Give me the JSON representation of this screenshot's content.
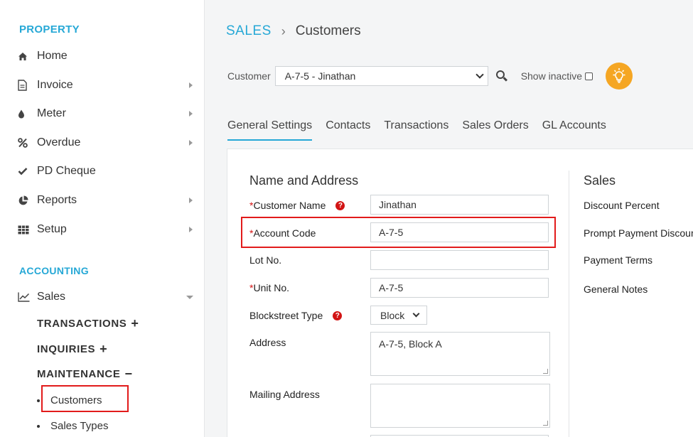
{
  "sidebar": {
    "property_heading": "PROPERTY",
    "property_items": [
      {
        "label": "Home",
        "icon": "home-icon"
      },
      {
        "label": "Invoice",
        "icon": "document-icon"
      },
      {
        "label": "Meter",
        "icon": "drop-icon"
      },
      {
        "label": "Overdue",
        "icon": "percent-icon"
      },
      {
        "label": "PD Cheque",
        "icon": "check-icon"
      },
      {
        "label": "Reports",
        "icon": "pie-chart-icon"
      },
      {
        "label": "Setup",
        "icon": "grid-icon"
      }
    ],
    "accounting_heading": "ACCOUNTING",
    "sales_label": "Sales",
    "sub_headings": {
      "transactions": "TRANSACTIONS",
      "inquiries": "INQUIRIES",
      "maintenance": "MAINTENANCE"
    },
    "plus_symbol": "+",
    "minus_symbol": "−",
    "maintenance_links": [
      "Customers",
      "Sales Types"
    ]
  },
  "breadcrumb": {
    "section": "SALES",
    "separator": "›",
    "page": "Customers"
  },
  "filter": {
    "customer_label": "Customer",
    "customer_value": "A-7-5 - Jinathan",
    "show_inactive_label": "Show inactive"
  },
  "tabs": [
    "General Settings",
    "Contacts",
    "Transactions",
    "Sales Orders",
    "GL Accounts"
  ],
  "name_address": {
    "title": "Name and Address",
    "customer_name_label": "Customer Name",
    "customer_name_value": "Jinathan",
    "account_code_label": "Account Code",
    "account_code_value": "A-7-5",
    "lot_no_label": "Lot No.",
    "lot_no_value": "",
    "unit_no_label": "Unit No.",
    "unit_no_value": "A-7-5",
    "blockstreet_type_label": "Blockstreet Type",
    "blockstreet_type_value": "Block",
    "address_label": "Address",
    "address_value": "A-7-5, Block A",
    "mailing_address_label": "Mailing Address",
    "mailing_address_value": "",
    "required_mark": "*",
    "help_mark": "?"
  },
  "sales": {
    "title": "Sales",
    "discount_percent_label": "Discount Percent",
    "prompt_payment_label": "Prompt Payment Discount",
    "payment_terms_label": "Payment Terms",
    "general_notes_label": "General Notes"
  },
  "colors": {
    "accent": "#26a8d6",
    "highlight": "#e21b1b",
    "required": "#d21414",
    "bulb": "#f5a623"
  }
}
